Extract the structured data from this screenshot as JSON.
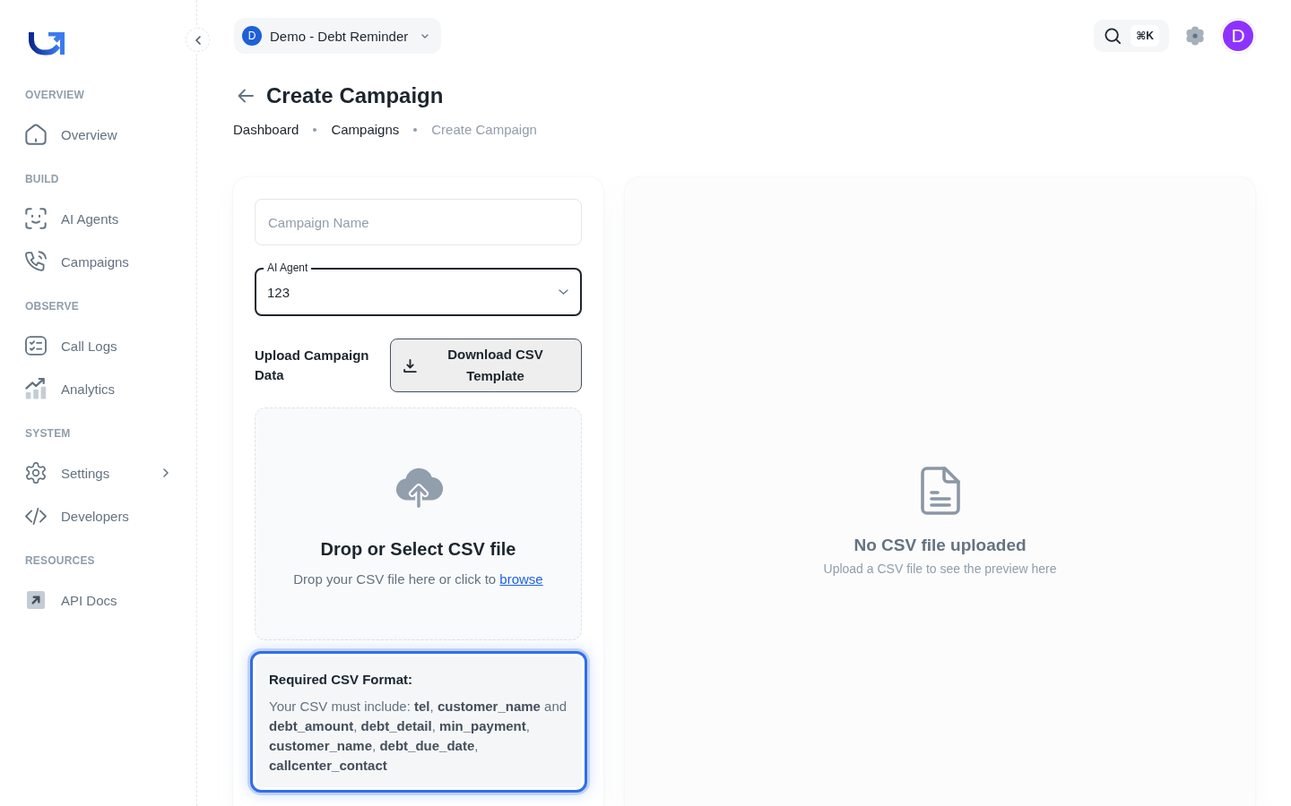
{
  "sidebar": {
    "sections": [
      {
        "heading": "OVERVIEW",
        "items": [
          {
            "label": "Overview",
            "selected": false
          }
        ]
      },
      {
        "heading": "BUILD",
        "items": [
          {
            "label": "AI Agents",
            "selected": false
          },
          {
            "label": "Campaigns",
            "selected": false
          }
        ]
      },
      {
        "heading": "OBSERVE",
        "items": [
          {
            "label": "Call Logs",
            "selected": false
          },
          {
            "label": "Analytics",
            "selected": false
          }
        ]
      },
      {
        "heading": "SYSTEM",
        "items": [
          {
            "label": "Settings",
            "selected": false,
            "expanded": false
          },
          {
            "label": "Developers",
            "selected": false
          }
        ]
      },
      {
        "heading": "RESOURCES",
        "items": [
          {
            "label": "API Docs",
            "selected": false
          }
        ]
      }
    ]
  },
  "header": {
    "workspace": {
      "initial": "D",
      "name": "Demo - Debt Reminder"
    },
    "search": {
      "shortcut": "⌘K"
    },
    "user": {
      "initial": "D"
    }
  },
  "page": {
    "title": "Create Campaign",
    "breadcrumbs": [
      {
        "label": "Dashboard",
        "current": false
      },
      {
        "label": "Campaigns",
        "current": false
      },
      {
        "label": "Create Campaign",
        "current": true
      }
    ]
  },
  "form": {
    "campaign_name": {
      "placeholder": "Campaign Name"
    },
    "ai_agent": {
      "label": "AI Agent",
      "value": "123",
      "focused": true
    },
    "upload": {
      "label": "Upload Campaign Data",
      "button": "Download CSV Template"
    },
    "drop_zone": {
      "title": "Drop or Select CSV file",
      "hint": "Drop your CSV file here or click to",
      "link": "browse"
    },
    "format_info": {
      "title": "Required CSV Format:",
      "text": "Your CSV must include: **tel**, **customer_name** and **debt_amount**, **debt_detail**, **min_payment**, **customer_name**, **debt_due_date**, **callcenter_contact**"
    }
  },
  "preview": {
    "title": "No CSV file uploaded",
    "subtitle": "Upload a CSV file to see the preview here"
  }
}
